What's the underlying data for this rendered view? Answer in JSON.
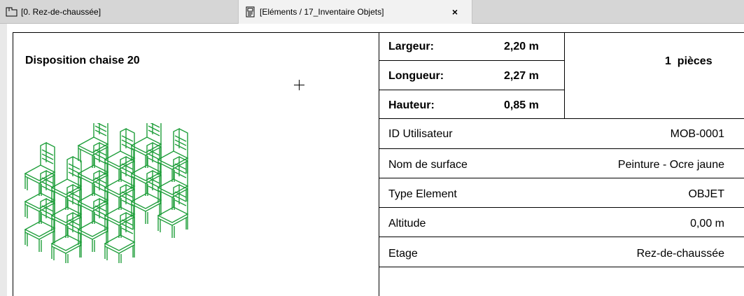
{
  "tabs": [
    {
      "label": "[0. Rez-de-chaussée]",
      "icon": "floor-plan-icon",
      "active": false
    },
    {
      "label": "[Eléments / 17_Inventaire Objets]",
      "icon": "document-icon",
      "active": true,
      "close_label": "×"
    }
  ],
  "object": {
    "title": "Disposition chaise 20",
    "icon": "chair-grid-icon",
    "accent_color": "#1e9e3a"
  },
  "dimensions": [
    {
      "label": "Largeur:",
      "value": "2,20 m"
    },
    {
      "label": "Longueur:",
      "value": "2,27 m"
    },
    {
      "label": "Hauteur:",
      "value": "0,85 m"
    }
  ],
  "quantity": "1  pièces",
  "properties": [
    {
      "label": "ID Utilisateur",
      "value": "MOB-0001"
    },
    {
      "label": "Nom de surface",
      "value": "Peinture - Ocre jaune"
    },
    {
      "label": "Type Element",
      "value": "OBJET"
    },
    {
      "label": "Altitude",
      "value": "0,00 m"
    },
    {
      "label": "Etage",
      "value": "Rez-de-chaussée"
    }
  ]
}
